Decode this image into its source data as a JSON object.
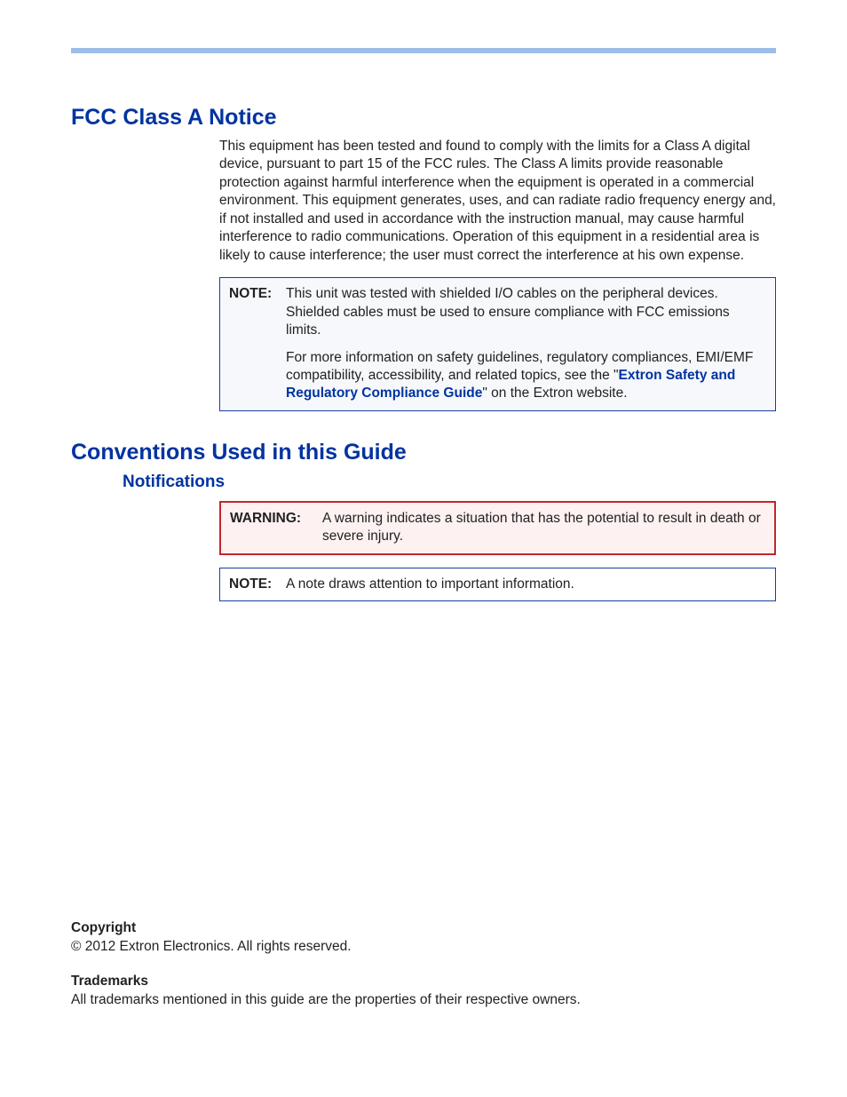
{
  "sections": {
    "fcc": {
      "title": "FCC Class A Notice",
      "body": "This equipment has been tested and found to comply with the limits for a Class A digital device, pursuant to part 15 of the FCC rules. The Class A limits provide reasonable protection against harmful interference when the equipment is operated in a commercial environment. This equipment generates, uses, and can radiate radio frequency energy and, if not installed and used in accordance with the instruction manual, may cause harmful interference to radio communications. Operation of this equipment in a residential area is likely to cause interference; the user must correct the interference at his own expense.",
      "note": {
        "label": "NOTE:",
        "para1": "This unit was tested with shielded I/O cables on the peripheral devices. Shielded cables must be used to ensure compliance with FCC emissions limits.",
        "para2_before": "For more information on safety guidelines, regulatory compliances, EMI/EMF compatibility, accessibility, and related topics, see the \"",
        "para2_link": "Extron Safety and Regulatory Compliance Guide",
        "para2_after": "\" on the Extron website."
      }
    },
    "conventions": {
      "title": "Conventions Used in this Guide",
      "notifications": {
        "heading": "Notifications",
        "warning": {
          "label": "WARNING:",
          "text": "A warning indicates a situation that has the potential to result in death or severe injury."
        },
        "note": {
          "label": "NOTE:",
          "text": "A note draws attention to important information."
        }
      }
    }
  },
  "footer": {
    "copyright": {
      "heading": "Copyright",
      "text": "© 2012  Extron Electronics. All rights reserved."
    },
    "trademarks": {
      "heading": "Trademarks",
      "text": "All trademarks mentioned in this guide are the properties of their respective owners."
    }
  }
}
